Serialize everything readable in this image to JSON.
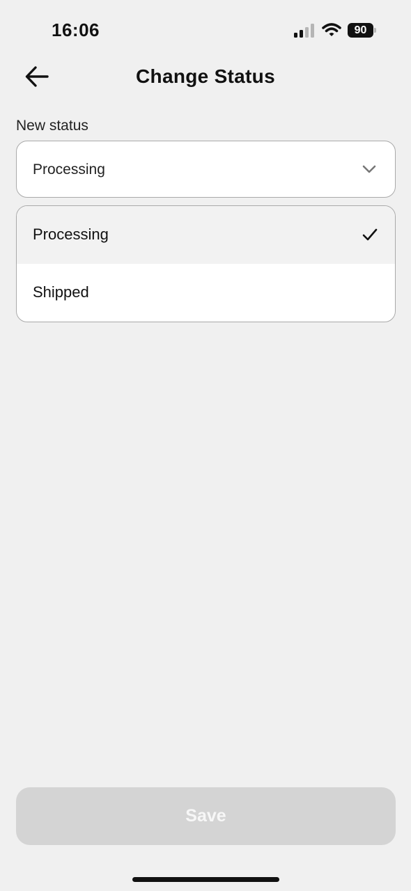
{
  "status_bar": {
    "time": "16:06",
    "battery_level": "90",
    "icons": [
      "signal-icon",
      "wifi-icon",
      "battery-icon"
    ]
  },
  "header": {
    "title": "Change Status",
    "back_icon": "arrow-left-icon"
  },
  "form": {
    "label": "New status",
    "selected_value": "Processing",
    "chevron_icon": "chevron-down-icon",
    "options": [
      {
        "label": "Processing",
        "selected": true
      },
      {
        "label": "Shipped",
        "selected": false
      }
    ],
    "check_icon": "checkmark-icon"
  },
  "footer": {
    "save_label": "Save",
    "save_enabled": false
  },
  "colors": {
    "background": "#f0f0f0",
    "card": "#ffffff",
    "border": "#a9a9a9",
    "selected_option_bg": "#f2f2f2",
    "save_disabled_bg": "#d4d4d4",
    "text": "#111111"
  }
}
